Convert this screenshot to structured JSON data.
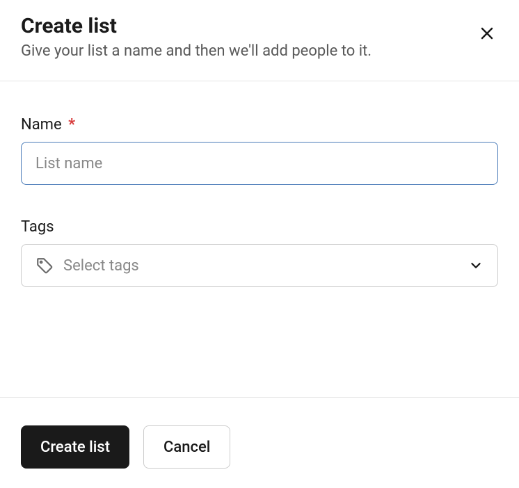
{
  "header": {
    "title": "Create list",
    "subtitle": "Give your list a name and then we'll add people to it."
  },
  "form": {
    "name": {
      "label": "Name",
      "placeholder": "List name",
      "value": ""
    },
    "tags": {
      "label": "Tags",
      "placeholder": "Select tags"
    }
  },
  "footer": {
    "primary_label": "Create list",
    "secondary_label": "Cancel"
  }
}
